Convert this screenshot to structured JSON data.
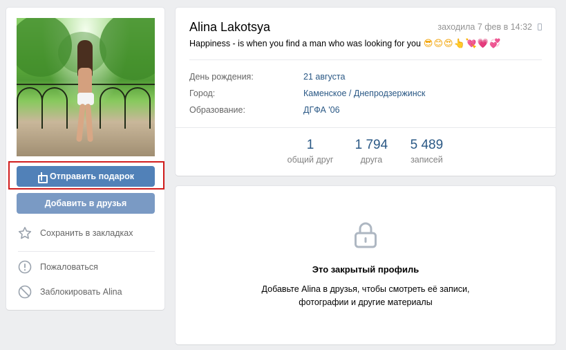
{
  "profile": {
    "name": "Alina Lakotsya",
    "last_seen": "заходила 7 фев в 14:32",
    "status_text": "Happiness - is when you find a man who was looking for you",
    "status_emoji": "😎😊😍👆💘💗💞"
  },
  "info": {
    "birthday_label": "День рождения:",
    "birthday_value": "21 августа",
    "city_label": "Город:",
    "city_value": "Каменское / Днепродзержинск",
    "education_label": "Образование:",
    "education_value": "ДГФА '06"
  },
  "counters": [
    {
      "value": "1",
      "label": "общий друг"
    },
    {
      "value": "1 794",
      "label": "друга"
    },
    {
      "value": "5 489",
      "label": "записей"
    }
  ],
  "actions": {
    "gift_label": "Отправить подарок",
    "add_friend_label": "Добавить в друзья",
    "bookmark_label": "Сохранить в закладках",
    "report_label": "Пожаловаться",
    "block_label": "Заблокировать Alina"
  },
  "closed_profile": {
    "title": "Это закрытый профиль",
    "description_line1": "Добавьте Alina в друзья, чтобы смотреть её записи,",
    "description_line2": "фотографии и другие материалы"
  },
  "colors": {
    "accent": "#5181b8",
    "link": "#2a5885",
    "highlight": "#d11c1c"
  },
  "icons": {
    "gift": "gift-icon",
    "star": "star-icon",
    "report": "exclamation-circle-icon",
    "block": "block-icon",
    "lock": "lock-icon",
    "phone": "phone-icon"
  }
}
